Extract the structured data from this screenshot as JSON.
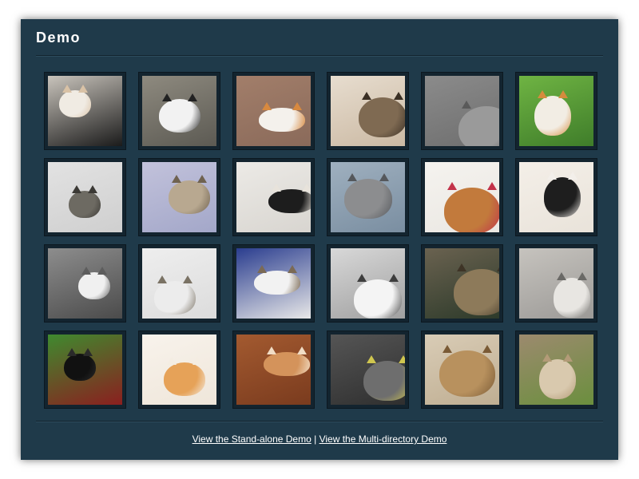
{
  "page": {
    "title": "Demo"
  },
  "gallery": {
    "thumbnails": [
      {
        "bg": "#1b1b1b",
        "bg2": "#c9c4bc",
        "body": "#f0ebe3",
        "spot": "#d9c2a6"
      },
      {
        "bg": "#5c5a53",
        "bg2": "#8e8a7f",
        "body": "#f2f2f2",
        "spot": "#222222"
      },
      {
        "bg": "#8a6a5a",
        "bg2": "#a27e6a",
        "body": "#f4f1ec",
        "spot": "#d8893f"
      },
      {
        "bg": "#cbb9a3",
        "bg2": "#e7ddcf",
        "body": "#7f6a52",
        "spot": "#3a2f24"
      },
      {
        "bg": "#6e6e6e",
        "bg2": "#8b8b8b",
        "body": "#9a9a9a",
        "spot": "#5a5a5a"
      },
      {
        "bg": "#3f7d2a",
        "bg2": "#6fb443",
        "body": "#f2ede4",
        "spot": "#d58b3d"
      },
      {
        "bg": "#cfcfcf",
        "bg2": "#e2e2e2",
        "body": "#6d6a62",
        "spot": "#3b3935"
      },
      {
        "bg": "#a3a7c9",
        "bg2": "#c2c2db",
        "body": "#b8a890",
        "spot": "#6f6250"
      },
      {
        "bg": "#d8d5d0",
        "bg2": "#eceae6",
        "body": "#1d1d1d",
        "spot": "#e8e3db"
      },
      {
        "bg": "#7a8ea1",
        "bg2": "#9fb0bf",
        "body": "#8c8d8f",
        "spot": "#55585c"
      },
      {
        "bg": "#eae7e2",
        "bg2": "#f5f3ef",
        "body": "#c27a3c",
        "spot": "#c3324a"
      },
      {
        "bg": "#e9e3da",
        "bg2": "#f4efe8",
        "body": "#1e1e1e",
        "spot": "#f3efea"
      },
      {
        "bg": "#4b4b4b",
        "bg2": "#8d8d8d",
        "body": "#f0f0f0",
        "spot": "#5d5d5d"
      },
      {
        "bg": "#dcdcdc",
        "bg2": "#eeeeee",
        "body": "#ececec",
        "spot": "#7a7264"
      },
      {
        "bg": "#e8e8e8",
        "bg2": "#2a3d8f",
        "body": "#f2f2f2",
        "spot": "#7b6a55"
      },
      {
        "bg": "#a0a0a0",
        "bg2": "#d8d8d8",
        "body": "#f4f4f4",
        "spot": "#3d3d3d"
      },
      {
        "bg": "#2d3a2a",
        "bg2": "#6a6250",
        "body": "#8d7a5a",
        "spot": "#3e3426"
      },
      {
        "bg": "#9c9a97",
        "bg2": "#c6c3be",
        "body": "#e8e6e2",
        "spot": "#6a6966"
      },
      {
        "bg": "#8b1f1f",
        "bg2": "#3f8a2f",
        "body": "#111111",
        "spot": "#2a2a2a"
      },
      {
        "bg": "#efe6da",
        "bg2": "#f8f3ec",
        "body": "#e6a258",
        "spot": "#f4ede2"
      },
      {
        "bg": "#7a3b1e",
        "bg2": "#a35a30",
        "body": "#d4935b",
        "spot": "#f1ddc5"
      },
      {
        "bg": "#2f2f2f",
        "bg2": "#555555",
        "body": "#6e6e6e",
        "spot": "#cfc64f"
      },
      {
        "bg": "#bfae92",
        "bg2": "#d9ccb6",
        "body": "#b8915e",
        "spot": "#7a5a35"
      },
      {
        "bg": "#6b8f3e",
        "bg2": "#9c8a6e",
        "body": "#d9c9ae",
        "spot": "#b39b78"
      }
    ]
  },
  "footer": {
    "link1": "View the Stand-alone Demo",
    "separator": "|",
    "link2": "View the Multi-directory Demo"
  },
  "colors": {
    "panel": "#1f3a4a",
    "frame": "#13242f",
    "text": "#ffffff"
  }
}
